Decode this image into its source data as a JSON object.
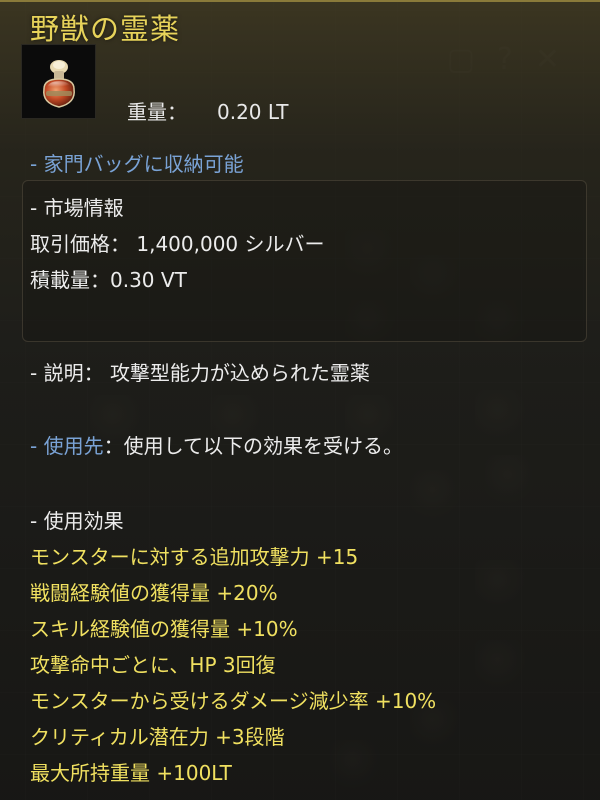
{
  "background": {
    "ghost_icons": [
      "document-icon",
      "question-icon",
      "close-icon"
    ]
  },
  "tooltip": {
    "item_name": "野獣の霊薬",
    "icon": "potion-flask-icon",
    "weight_label": "重量：",
    "weight_value": "0.20 LT",
    "storage_note": "- 家門バッグに収納可能",
    "market": {
      "header": "- 市場情報",
      "price_label": "取引価格：",
      "price_value": "1,400,000 シルバー",
      "capacity_label": "積載量：",
      "capacity_value": "0.30 VT"
    },
    "description_label": "- 説明：",
    "description_text": "攻撃型能力が込められた霊薬",
    "usage_label": "- 使用先",
    "usage_text": "：使用して以下の効果を受ける。",
    "effects_header": "- 使用効果",
    "effects": [
      "モンスターに対する追加攻撃力 +15",
      "戦闘経験値の獲得量 +20%",
      "スキル経験値の獲得量 +10%",
      "攻撃命中ごとに、HP 3回復",
      "モンスターから受けるダメージ減少率 +10%",
      "クリティカル潜在力 +3段階",
      "最大所持重量 +100LT"
    ]
  },
  "colors": {
    "title": "#e7d35a",
    "text": "#ececec",
    "link_blue": "#7aa3d6",
    "effect_yellow": "#f0e060"
  }
}
